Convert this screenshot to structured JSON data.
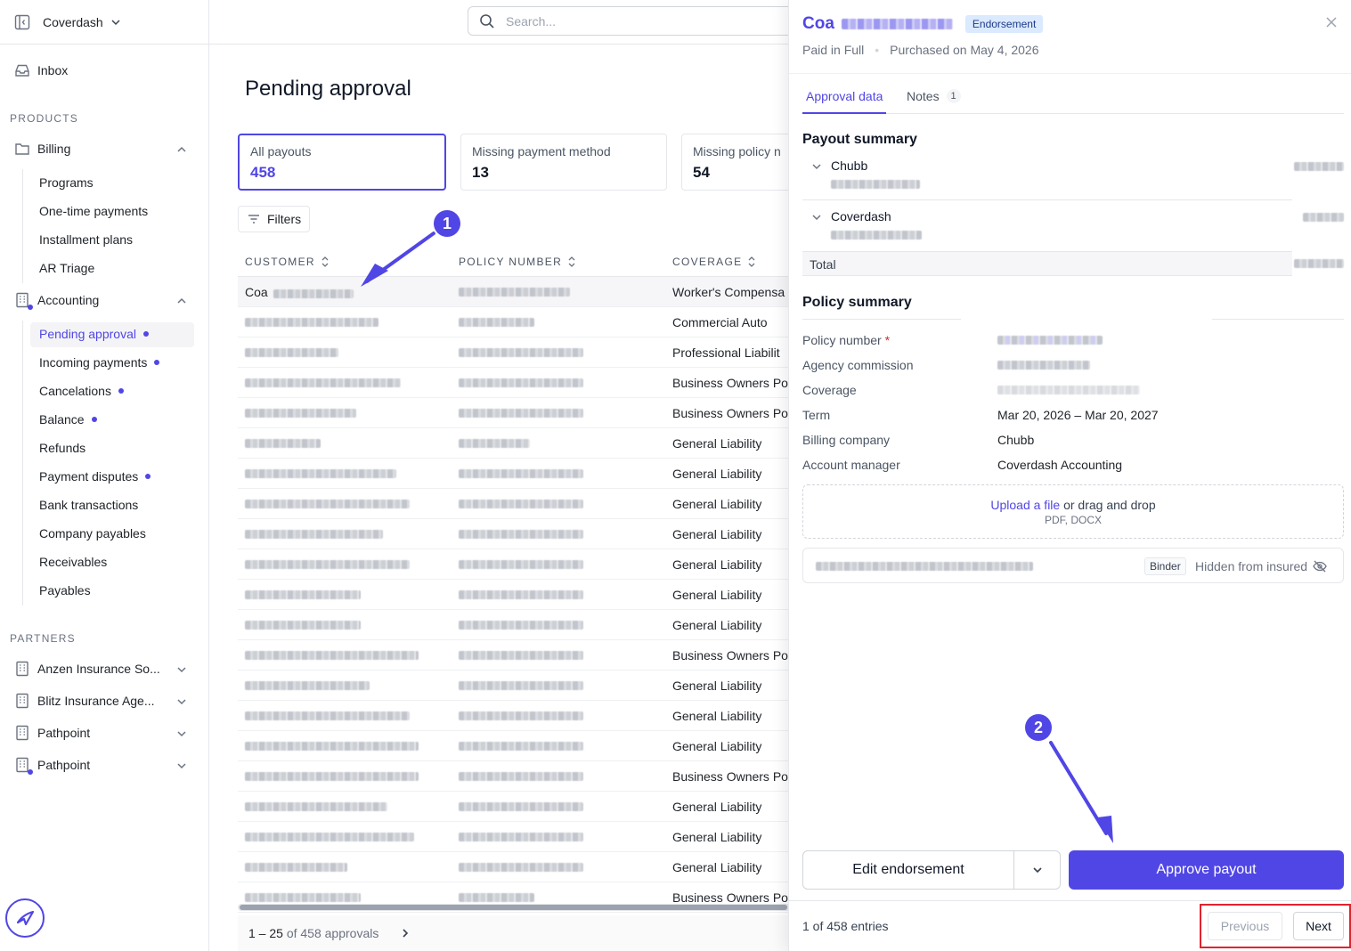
{
  "sidebar": {
    "org_name": "Coverdash",
    "inbox_label": "Inbox",
    "products_heading": "PRODUCTS",
    "billing_label": "Billing",
    "billing_items": [
      "Programs",
      "One-time payments",
      "Installment plans",
      "AR Triage"
    ],
    "accounting_label": "Accounting",
    "accounting_items": [
      {
        "label": "Pending approval",
        "dot": true
      },
      {
        "label": "Incoming payments",
        "dot": true
      },
      {
        "label": "Cancelations",
        "dot": true
      },
      {
        "label": "Balance",
        "dot": true
      },
      {
        "label": "Refunds",
        "dot": false
      },
      {
        "label": "Payment disputes",
        "dot": true
      },
      {
        "label": "Bank transactions",
        "dot": false
      },
      {
        "label": "Company payables",
        "dot": false
      },
      {
        "label": "Receivables",
        "dot": false
      },
      {
        "label": "Payables",
        "dot": false
      }
    ],
    "partners_heading": "PARTNERS",
    "partners": [
      "Anzen Insurance So...",
      "Blitz Insurance Age...",
      "Pathpoint",
      "Pathpoint"
    ]
  },
  "search": {
    "placeholder": "Search..."
  },
  "main": {
    "title": "Pending approval",
    "cards": [
      {
        "label": "All payouts",
        "value": "458"
      },
      {
        "label": "Missing payment method",
        "value": "13"
      },
      {
        "label": "Missing policy n",
        "value": "54"
      }
    ],
    "filters_label": "Filters",
    "columns": [
      "CUSTOMER",
      "POLICY NUMBER",
      "COVERAGE"
    ],
    "first_customer_prefix": "Coa",
    "coverages": [
      "Worker's Compensa",
      "Commercial Auto",
      "Professional Liabilit",
      "Business Owners Po",
      "Business Owners Po",
      "General Liability",
      "General Liability",
      "General Liability",
      "General Liability",
      "General Liability",
      "General Liability",
      "General Liability",
      "Business Owners Po",
      "General Liability",
      "General Liability",
      "General Liability",
      "Business Owners Po",
      "General Liability",
      "General Liability",
      "General Liability",
      "Business Owners Po"
    ],
    "pager_range": "1 – 25",
    "pager_of": "of 458 approvals"
  },
  "panel": {
    "title_prefix": "Coa",
    "badge": "Endorsement",
    "status": "Paid in Full",
    "purchased": "Purchased on May 4, 2026",
    "tabs": [
      {
        "label": "Approval data"
      },
      {
        "label": "Notes",
        "count": "1"
      }
    ],
    "payout_summary_heading": "Payout summary",
    "payout_parties": [
      "Chubb",
      "Coverdash"
    ],
    "total_label": "Total",
    "policy_summary_heading": "Policy summary",
    "policy_fields": {
      "policy_number_label": "Policy number",
      "agency_commission_label": "Agency commission",
      "coverage_label": "Coverage",
      "term_label": "Term",
      "term_value": "Mar 20, 2026 – Mar 20, 2027",
      "billing_company_label": "Billing company",
      "billing_company_value": "Chubb",
      "account_manager_label": "Account manager",
      "account_manager_value": "Coverdash Accounting"
    },
    "upload": {
      "link": "Upload a file",
      "rest": " or drag and drop",
      "hint": "PDF, DOCX"
    },
    "file": {
      "tag": "Binder",
      "visibility": "Hidden from insured"
    },
    "edit_button": "Edit endorsement",
    "approve_button": "Approve payout",
    "entries": "1 of 458 entries",
    "previous": "Previous",
    "next": "Next"
  },
  "annotations": {
    "marker1": "1",
    "marker2": "2"
  },
  "colors": {
    "accent": "#5046e5",
    "highlight_box": "#e0242f"
  }
}
